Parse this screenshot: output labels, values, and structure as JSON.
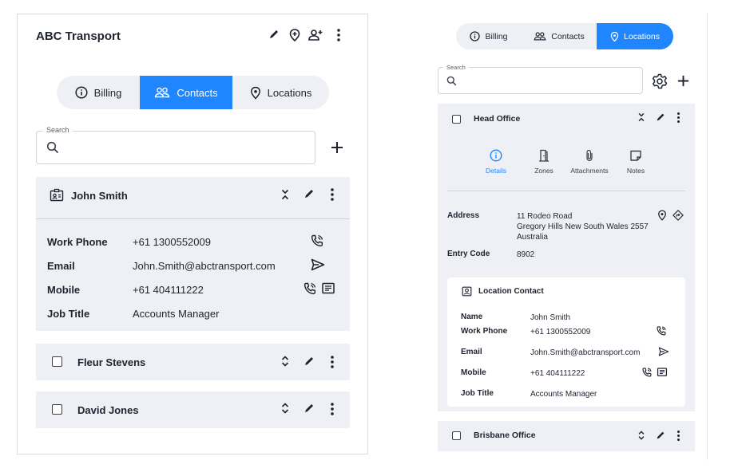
{
  "left": {
    "header": {
      "title": "ABC Transport"
    },
    "tabs": [
      {
        "label": "Billing",
        "icon": "info-icon"
      },
      {
        "label": "Contacts",
        "icon": "people-icon",
        "active": true
      },
      {
        "label": "Locations",
        "icon": "map-pin-icon"
      }
    ],
    "search": {
      "label": "Search",
      "placeholder": ""
    },
    "expanded_contact": {
      "name": "John Smith",
      "fields": [
        {
          "label": "Work Phone",
          "value": "+61 1300552009"
        },
        {
          "label": "Email",
          "value": "John.Smith@abctransport.com"
        },
        {
          "label": "Mobile",
          "value": "+61 404111222"
        },
        {
          "label": "Job Title",
          "value": "Accounts Manager"
        }
      ]
    },
    "contacts": [
      {
        "name": "Fleur Stevens"
      },
      {
        "name": "David Jones"
      }
    ]
  },
  "right": {
    "tabs": [
      {
        "label": "Billing",
        "icon": "info-icon"
      },
      {
        "label": "Contacts",
        "icon": "people-icon"
      },
      {
        "label": "Locations",
        "icon": "map-pin-icon",
        "active": true
      }
    ],
    "search": {
      "label": "Search",
      "placeholder": ""
    },
    "location": {
      "name": "Head Office",
      "subtabs": [
        {
          "label": "Details",
          "icon": "info-icon",
          "active": true
        },
        {
          "label": "Zones",
          "icon": "door-icon"
        },
        {
          "label": "Attachments",
          "icon": "paperclip-icon"
        },
        {
          "label": "Notes",
          "icon": "note-icon"
        }
      ],
      "address_label": "Address",
      "address_lines": [
        "11 Rodeo Road",
        "Gregory Hills New South Wales 2557",
        "Australia"
      ],
      "entry_code_label": "Entry Code",
      "entry_code": "8902",
      "contact_card": {
        "title": "Location Contact",
        "fields": [
          {
            "label": "Name",
            "value": "John Smith"
          },
          {
            "label": "Work Phone",
            "value": "+61 1300552009"
          },
          {
            "label": "Email",
            "value": "John.Smith@abctransport.com"
          },
          {
            "label": "Mobile",
            "value": "+61 404111222"
          },
          {
            "label": "Job Title",
            "value": "Accounts Manager"
          }
        ]
      }
    },
    "other_locations": [
      {
        "name": "Brisbane Office"
      }
    ]
  },
  "colors": {
    "accent": "#1f86ff",
    "card_bg": "#eef0f5",
    "text": "#1f2330"
  }
}
